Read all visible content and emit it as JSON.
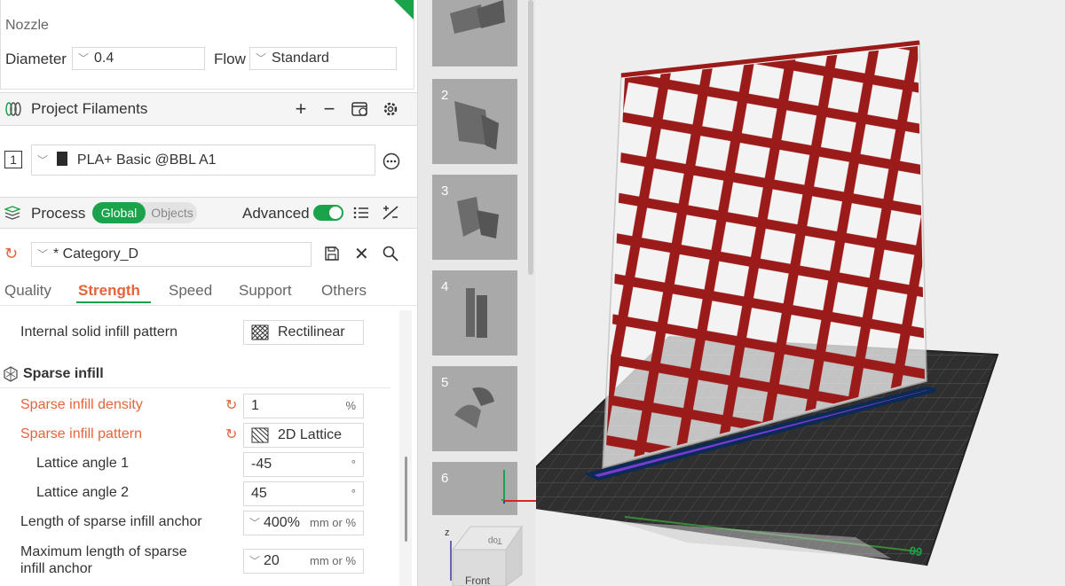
{
  "nozzle": {
    "title": "Nozzle",
    "diameter_label": "Diameter",
    "diameter_value": "0.4",
    "flow_label": "Flow",
    "flow_value": "Standard"
  },
  "filaments": {
    "title": "Project Filaments",
    "slot_index": "1",
    "filament_name": "PLA+ Basic @BBL A1",
    "filament_color": "#2a2a2a"
  },
  "process": {
    "title": "Process",
    "global_label": "Global",
    "objects_label": "Objects",
    "advanced_label": "Advanced",
    "preset": "* Category_D",
    "tabs": [
      "Quality",
      "Strength",
      "Speed",
      "Support",
      "Others"
    ],
    "active_tab": "Strength"
  },
  "settings": {
    "internal_pattern_label": "Internal solid infill pattern",
    "internal_pattern_value": "Rectilinear",
    "sparse_infill_title": "Sparse infill",
    "density_label": "Sparse infill density",
    "density_value": "1",
    "density_unit": "%",
    "pattern_label": "Sparse infill pattern",
    "pattern_value": "2D Lattice",
    "lattice1_label": "Lattice angle 1",
    "lattice1_value": "-45",
    "lattice2_label": "Lattice angle 2",
    "lattice2_value": "45",
    "degree_unit": "°",
    "anchor_label": "Length of sparse infill anchor",
    "anchor_value": "400%",
    "anchor_unit": "mm or %",
    "max_anchor_label_1": "Maximum length of sparse",
    "max_anchor_label_2": "infill anchor",
    "max_anchor_value": "20",
    "max_anchor_unit": "mm or %"
  },
  "thumbnails": [
    "2",
    "3",
    "4",
    "5",
    "6"
  ],
  "viewport": {
    "axis_z": "z",
    "cube_front": "Front",
    "cube_top": "Top",
    "plate_number": "09"
  },
  "colors": {
    "accent_green": "#1aa34a",
    "modified_orange": "#e5643a",
    "lattice_red": "#9b1a1a",
    "plate_dark": "#2f2f2f"
  }
}
